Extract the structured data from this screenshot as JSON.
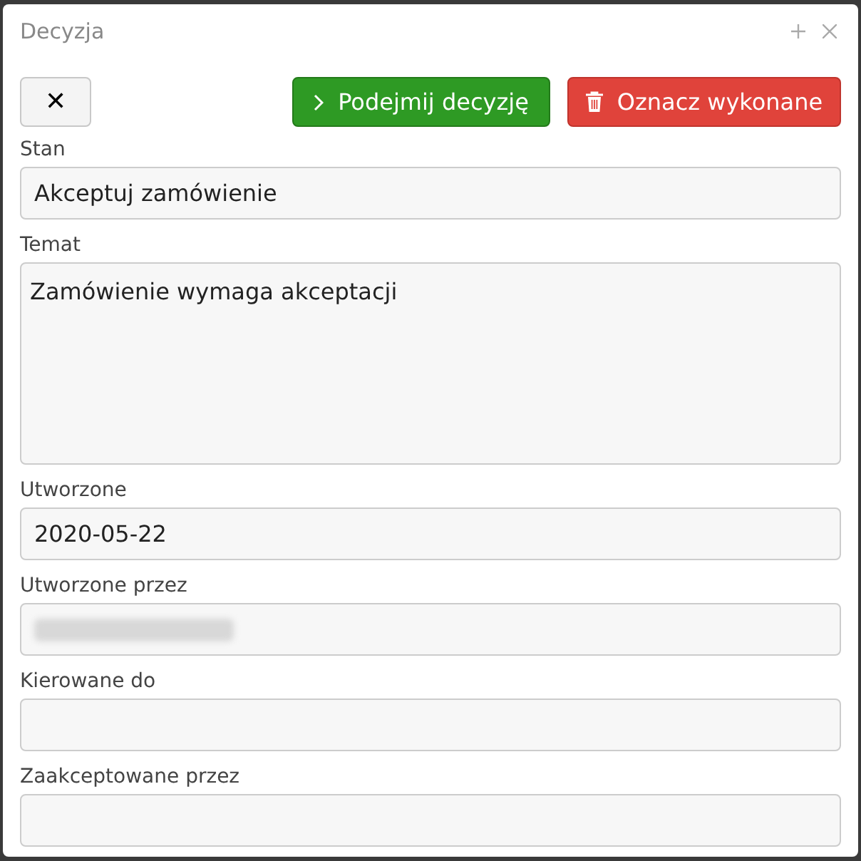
{
  "dialog": {
    "title": "Decyzja"
  },
  "buttons": [
    {
      "kind": "close",
      "label": "✕"
    },
    {
      "kind": "primary",
      "label": "Podejmij decyzję"
    },
    {
      "kind": "danger",
      "label": "Oznacz wykonane"
    }
  ],
  "fields": [
    {
      "label": "Stan",
      "kind": "input",
      "value": "Akceptuj zamówienie"
    },
    {
      "label": "Temat",
      "kind": "textarea",
      "value": "Zamówienie wymaga akceptacji"
    },
    {
      "label": "Utworzone",
      "kind": "input",
      "value": "2020-05-22"
    },
    {
      "label": "Utworzone przez",
      "kind": "redacted"
    },
    {
      "label": "Kierowane do",
      "kind": "input"
    },
    {
      "label": "Zaakceptowane przez",
      "kind": "input"
    }
  ]
}
